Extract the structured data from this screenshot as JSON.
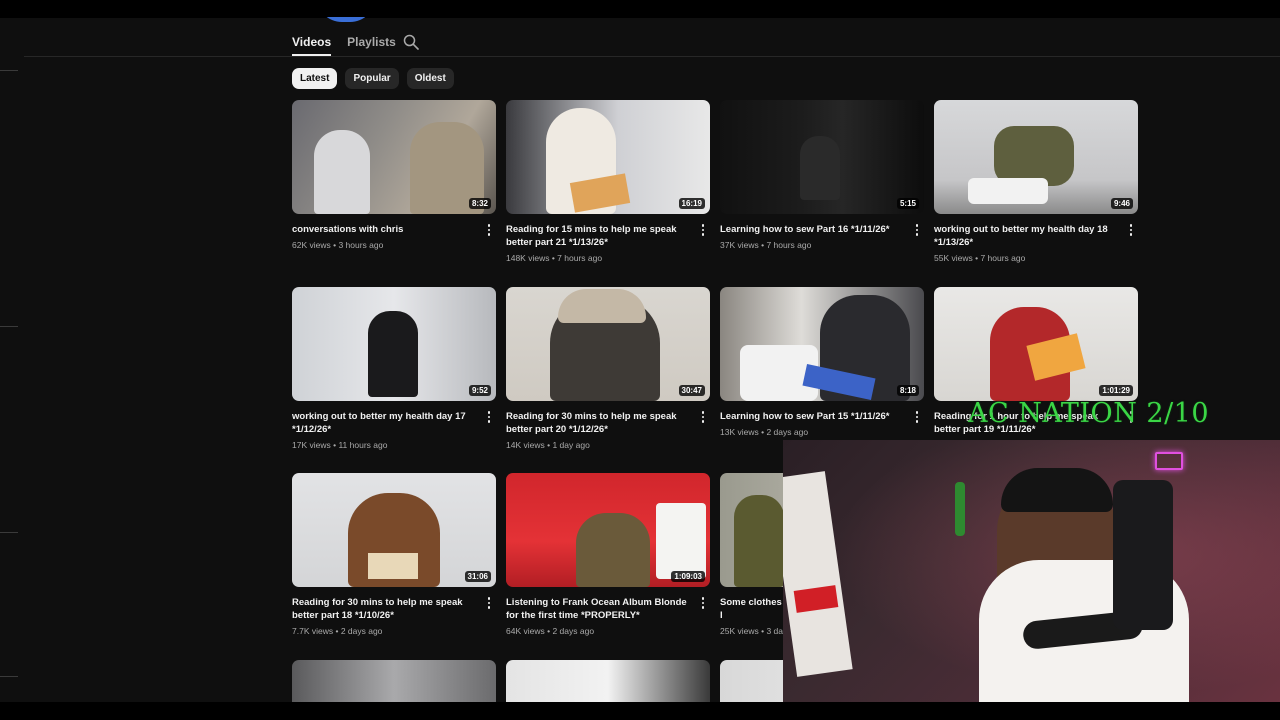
{
  "tabs": [
    {
      "label": "Videos",
      "active": true
    },
    {
      "label": "Playlists",
      "active": false
    }
  ],
  "search_icon": "search-icon",
  "chips": [
    {
      "label": "Latest",
      "active": true
    },
    {
      "label": "Popular",
      "active": false
    },
    {
      "label": "Oldest",
      "active": false
    }
  ],
  "videos": [
    {
      "title": "conversations with chris",
      "views": "62K views",
      "age": "3 hours ago",
      "duration": "8:32"
    },
    {
      "title": "Reading for 15 mins to help me speak better part 21 *1/13/26*",
      "views": "148K views",
      "age": "7 hours ago",
      "duration": "16:19"
    },
    {
      "title": "Learning how to sew Part 16 *1/11/26*",
      "views": "37K views",
      "age": "7 hours ago",
      "duration": "5:15"
    },
    {
      "title": "working out to better my health day 18 *1/13/26*",
      "views": "55K views",
      "age": "7 hours ago",
      "duration": "9:46"
    },
    {
      "title": "working out to better my health day 17 *1/12/26*",
      "views": "17K views",
      "age": "11 hours ago",
      "duration": "9:52"
    },
    {
      "title": "Reading for 30 mins to help me speak better part 20 *1/12/26*",
      "views": "14K views",
      "age": "1 day ago",
      "duration": "30:47"
    },
    {
      "title": "Learning how to sew Part 15 *1/11/26*",
      "views": "13K views",
      "age": "2 days ago",
      "duration": "8:18"
    },
    {
      "title": "Reading for 1 hour to help me speak better part 19 *1/11/26*",
      "views": "",
      "age": "",
      "duration": "1:01:29"
    },
    {
      "title": "Reading for 30 mins to help me speak better part 18 *1/10/26*",
      "views": "7.7K views",
      "age": "2 days ago",
      "duration": "31:06"
    },
    {
      "title": "Listening to Frank Ocean Album Blonde for the first time *PROPERLY*",
      "views": "64K views",
      "age": "2 days ago",
      "duration": "1:09:03"
    },
    {
      "title": "Some clothes I",
      "views": "25K views",
      "age": "3 day",
      "duration": ""
    }
  ],
  "overlay": {
    "text": "AC NATION 2/10"
  },
  "colors": {
    "background": "#0f0f0f",
    "chip_active": "#f1f1f1",
    "chip": "#272727",
    "overlay_text": "#3bd646"
  }
}
